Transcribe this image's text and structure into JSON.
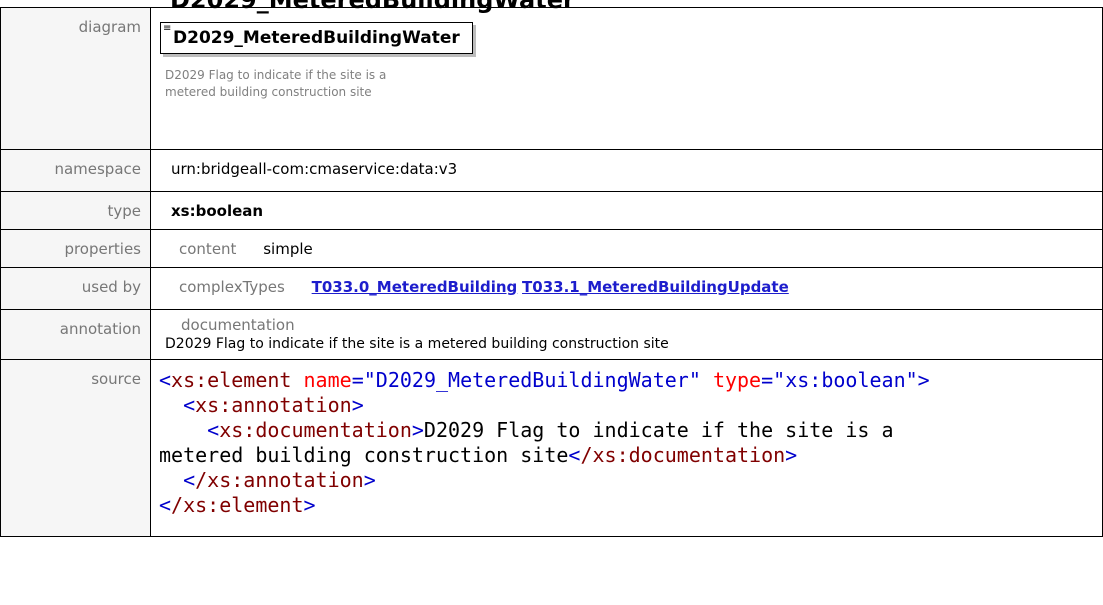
{
  "header": {
    "title_fragment": "_ ... g"
  },
  "labels": {
    "diagram": "diagram",
    "namespace": "namespace",
    "type": "type",
    "properties": "properties",
    "used_by": "used by",
    "annotation": "annotation",
    "source": "source"
  },
  "diagram": {
    "element_name": "D2029_MeteredBuildingWater",
    "doc_line1": "D2029 Flag to indicate if the site is a",
    "doc_line2": "metered building construction site"
  },
  "namespace": "urn:bridgeall-com:cmaservice:data:v3",
  "type": "xs:boolean",
  "properties": {
    "key": "content",
    "value": "simple"
  },
  "used_by": {
    "kind": "complexTypes",
    "links": [
      "T033.0_MeteredBuilding",
      "T033.1_MeteredBuildingUpdate"
    ]
  },
  "annotation": {
    "kind": "documentation",
    "text": "D2029 Flag to indicate if the site is a metered building construction site"
  },
  "source": {
    "open_tag": "xs:element",
    "attr_name": "name",
    "name_value": "\"D2029_MeteredBuildingWater\"",
    "attr_type": "type",
    "type_value": "\"xs:boolean\"",
    "annotation_tag": "xs:annotation",
    "documentation_tag": "xs:documentation",
    "doc_line1": "D2029 Flag to indicate if the site is a",
    "doc_line2": "metered building construction site",
    "close_documentation_tag": "/xs:documentation",
    "close_annotation_tag": "/xs:annotation",
    "close_element_tag": "/xs:element"
  }
}
